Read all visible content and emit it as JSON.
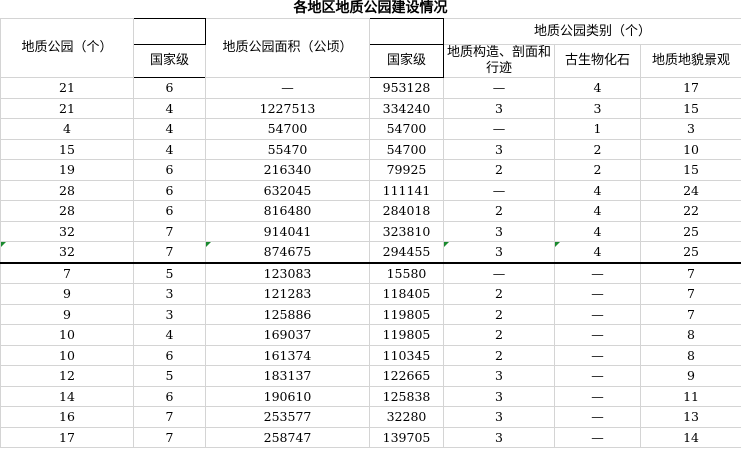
{
  "title": "各地区地质公园建设情况",
  "headers": {
    "parks": "地质公园（个）",
    "parks_national": "国家级",
    "area": "地质公园面积（公顷）",
    "area_national": "国家级",
    "category_group": "地质公园类别（个）",
    "cat_structure": "地质构造、剖面和行迹",
    "cat_fossil": "古生物化石",
    "cat_landform": "地质地貌景观"
  },
  "rows": [
    [
      "21",
      "6",
      "—",
      "953128",
      "—",
      "4",
      "17"
    ],
    [
      "21",
      "4",
      "1227513",
      "334240",
      "3",
      "3",
      "15"
    ],
    [
      "4",
      "4",
      "54700",
      "54700",
      "—",
      "1",
      "3"
    ],
    [
      "15",
      "4",
      "55470",
      "54700",
      "3",
      "2",
      "10"
    ],
    [
      "19",
      "6",
      "216340",
      "79925",
      "2",
      "2",
      "15"
    ],
    [
      "28",
      "6",
      "632045",
      "111141",
      "—",
      "4",
      "24"
    ],
    [
      "28",
      "6",
      "816480",
      "284018",
      "2",
      "4",
      "22"
    ],
    [
      "32",
      "7",
      "914041",
      "323810",
      "3",
      "4",
      "25"
    ],
    [
      "32",
      "7",
      "874675",
      "294455",
      "3",
      "4",
      "25"
    ],
    [
      "7",
      "5",
      "123083",
      "15580",
      "—",
      "—",
      "7"
    ],
    [
      "9",
      "3",
      "121283",
      "118405",
      "2",
      "—",
      "7"
    ],
    [
      "9",
      "3",
      "125886",
      "119805",
      "2",
      "—",
      "7"
    ],
    [
      "10",
      "4",
      "169037",
      "119805",
      "2",
      "—",
      "8"
    ],
    [
      "10",
      "6",
      "161374",
      "110345",
      "2",
      "—",
      "8"
    ],
    [
      "12",
      "5",
      "183137",
      "122665",
      "3",
      "—",
      "9"
    ],
    [
      "14",
      "6",
      "190610",
      "125838",
      "3",
      "—",
      "11"
    ],
    [
      "16",
      "7",
      "253577",
      "32280",
      "3",
      "—",
      "13"
    ],
    [
      "17",
      "7",
      "258747",
      "139705",
      "3",
      "—",
      "14"
    ]
  ],
  "colors": {
    "cell_mark": "#1a8a2f",
    "grid": "#d4d4d4"
  }
}
